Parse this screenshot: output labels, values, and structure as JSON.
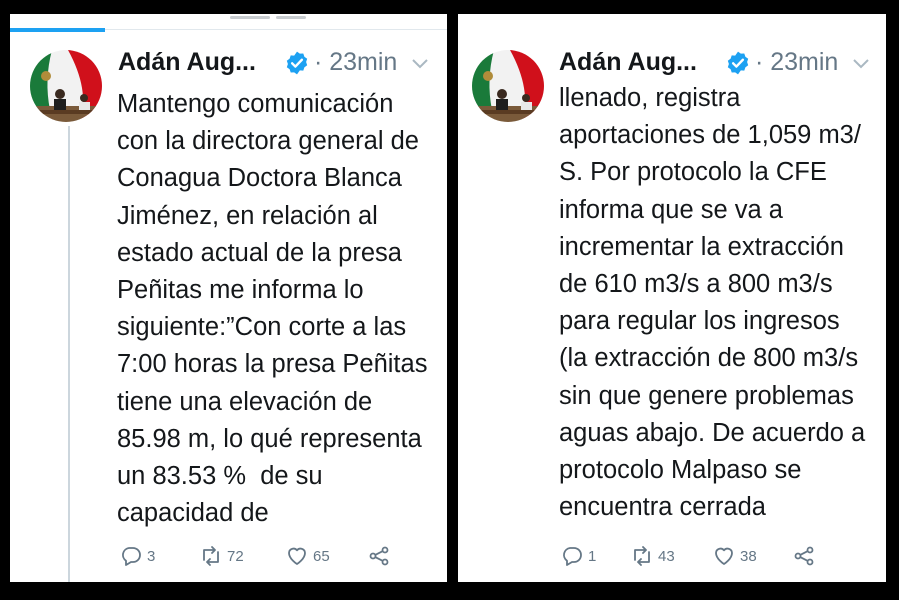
{
  "tweets": [
    {
      "author_name": "Adán Aug...",
      "time": "23min",
      "lines": [
        "Mantengo comunicación",
        "con la directora general de",
        "Conagua Doctora Blanca",
        "Jiménez, en relación al",
        "estado actual de la presa",
        "Peñitas me informa lo",
        "siguiente:”Con corte a las",
        "7:00 horas la presa Peñitas",
        "tiene una elevación de",
        "85.98 m, lo qué representa",
        "un 83.53 %  de su",
        "capacidad de"
      ],
      "replies": "3",
      "retweets": "72",
      "likes": "65"
    },
    {
      "author_name": "Adán Aug...",
      "time": "23min",
      "lines": [
        "llenado, registra",
        "aportaciones de 1,059 m3/",
        "S. Por protocolo la CFE",
        "informa que se va a",
        "incrementar la extracción",
        "de 610 m3/s a 800 m3/s",
        "para regular los ingresos",
        "(la extracción de 800 m3/s",
        "sin que genere problemas",
        "aguas abajo. De acuerdo a",
        "protocolo Malpaso se",
        "encuentra cerrada"
      ],
      "replies": "1",
      "retweets": "43",
      "likes": "38"
    }
  ],
  "icons": {
    "verified": "verified-badge-icon",
    "menu": "chevron-down-icon",
    "reply": "reply-icon",
    "retweet": "retweet-icon",
    "like": "heart-icon",
    "share": "share-icon"
  },
  "colors": {
    "background": "#000000",
    "card": "#ffffff",
    "text": "#14171a",
    "muted": "#657786",
    "accent": "#1da1f2",
    "thread_line": "#ccd6dd"
  }
}
